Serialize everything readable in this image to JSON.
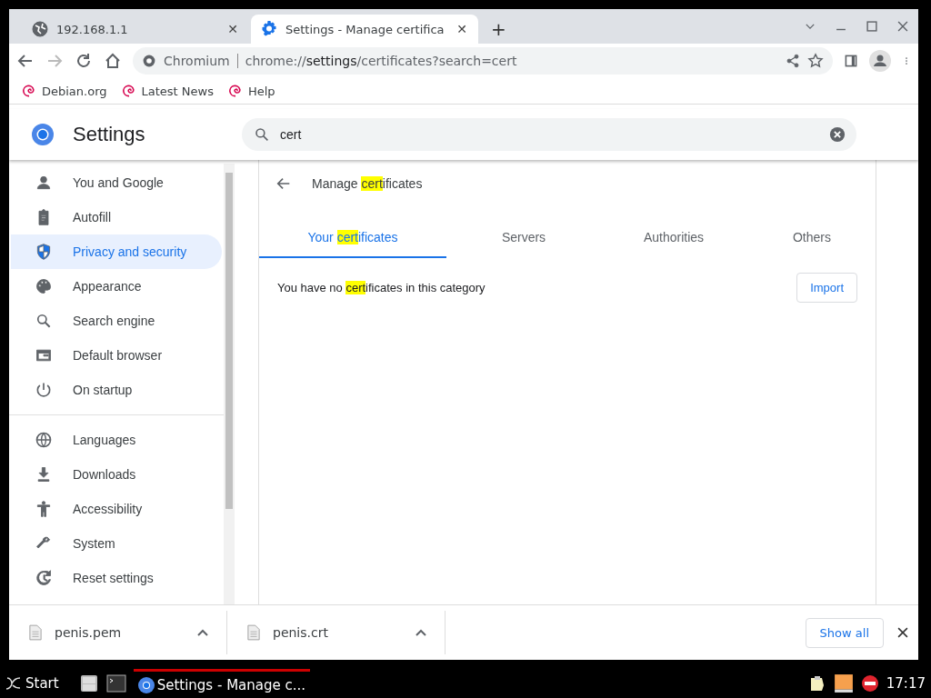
{
  "tabs": [
    {
      "title": "192.168.1.1",
      "close": "✕",
      "selected": false
    },
    {
      "title": "Settings - Manage certifica",
      "close": "✕",
      "selected": true
    }
  ],
  "new_tab": "+",
  "address_bar": {
    "site": "Chromium",
    "url": [
      {
        "text": "chrome://",
        "strong": false
      },
      {
        "text": "settings",
        "strong": true
      },
      {
        "text": "/certificates?search=cert",
        "strong": false
      }
    ]
  },
  "bookmarks": [
    "Debian.org",
    "Latest News",
    "Help"
  ],
  "settings": {
    "title": "Settings",
    "search": {
      "value": "cert"
    },
    "sidebar": {
      "groups": [
        [
          {
            "label": "You and Google",
            "selected": false
          },
          {
            "label": "Autofill",
            "selected": false
          },
          {
            "label": "Privacy and security",
            "selected": true
          },
          {
            "label": "Appearance",
            "selected": false
          },
          {
            "label": "Search engine",
            "selected": false
          },
          {
            "label": "Default browser",
            "selected": false
          },
          {
            "label": "On startup",
            "selected": false
          }
        ],
        [
          {
            "label": "Languages",
            "selected": false
          },
          {
            "label": "Downloads",
            "selected": false
          },
          {
            "label": "Accessibility",
            "selected": false
          },
          {
            "label": "System",
            "selected": false
          },
          {
            "label": "Reset settings",
            "selected": false
          }
        ]
      ]
    },
    "page": {
      "title": [
        {
          "text": "Manage ",
          "highlighted": false
        },
        {
          "text": "cert",
          "highlighted": true
        },
        {
          "text": "ificates",
          "highlighted": false
        }
      ],
      "tabs": [
        {
          "label": [
            {
              "text": "Your ",
              "highlighted": false
            },
            {
              "text": "cert",
              "highlighted": true
            },
            {
              "text": "ificates",
              "highlighted": false
            }
          ],
          "selected": true
        },
        {
          "label": [
            {
              "text": "Servers",
              "highlighted": false
            }
          ],
          "selected": false
        },
        {
          "label": [
            {
              "text": "Authorities",
              "highlighted": false
            }
          ],
          "selected": false
        },
        {
          "label": [
            {
              "text": "Others",
              "highlighted": false
            }
          ],
          "selected": false
        }
      ],
      "message": [
        {
          "text": "You have no ",
          "highlighted": false
        },
        {
          "text": "cert",
          "highlighted": true
        },
        {
          "text": "ificates in this category",
          "highlighted": false
        }
      ],
      "import_button": "Import"
    }
  },
  "downloads": {
    "items": [
      "penis.pem",
      "penis.crt"
    ],
    "show_all": "Show all"
  },
  "taskbar": {
    "start": "Start",
    "task": "Settings - Manage c...",
    "clock": "17:17"
  }
}
